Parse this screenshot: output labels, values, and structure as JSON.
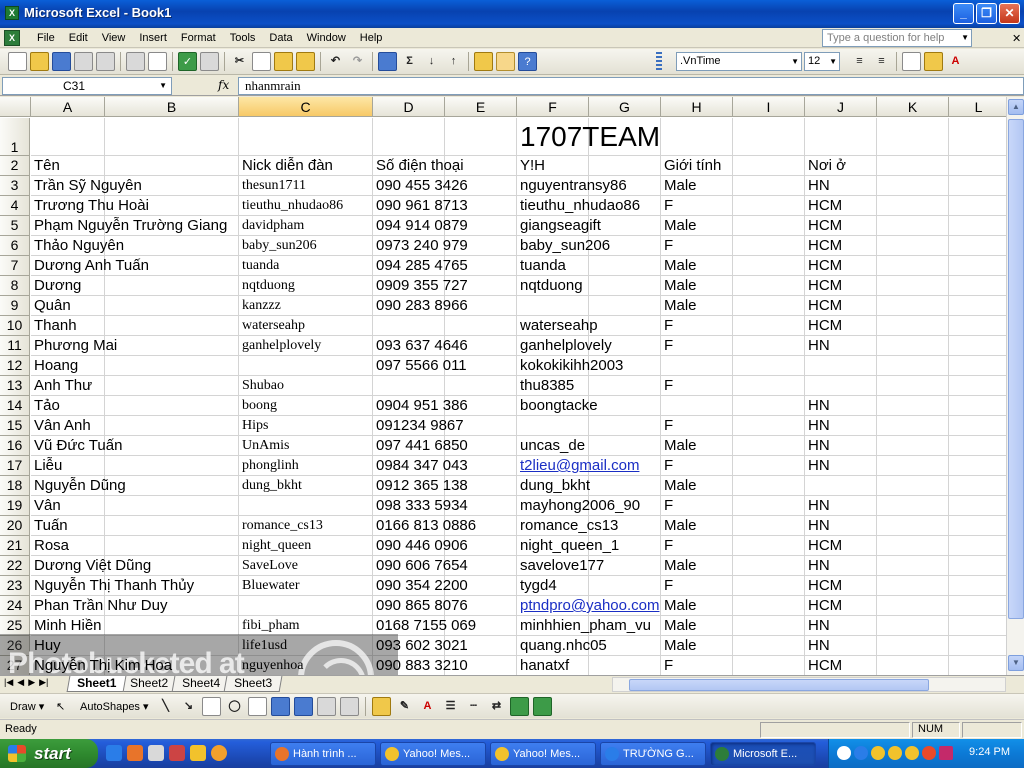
{
  "window": {
    "title": "Microsoft Excel - Book1"
  },
  "menu": {
    "items": [
      "File",
      "Edit",
      "View",
      "Insert",
      "Format",
      "Tools",
      "Data",
      "Window",
      "Help"
    ],
    "ask_placeholder": "Type a question for help"
  },
  "toolbar": {
    "sum_symbol": "Σ",
    "font_name": ".VnTime",
    "font_size": "12"
  },
  "formula_bar": {
    "cell_ref": "C31",
    "fx": "fx",
    "content": "nhanmrain"
  },
  "columns": [
    "A",
    "B",
    "C",
    "D",
    "E",
    "F",
    "G",
    "H",
    "I",
    "J",
    "K",
    "L"
  ],
  "rows": [
    {
      "n": "1",
      "title": "1707TEAM"
    },
    {
      "n": "2",
      "name": "Tên",
      "nick": "Nick diễn đàn",
      "phone": "Số điện thoại",
      "yh": "Y!H",
      "gender": "Giới tính",
      "place": "Nơi ở"
    },
    {
      "n": "3",
      "name": "Trần Sỹ Nguyên",
      "nick": "thesun1711",
      "phone": "090 455 3426",
      "yh": "nguyentransy86",
      "gender": "Male",
      "place": "HN"
    },
    {
      "n": "4",
      "name": "Trương Thu Hoài",
      "nick": "tieuthu_nhudao86",
      "phone": "090 961 8713",
      "yh": "tieuthu_nhudao86",
      "gender": "F",
      "place": "HCM"
    },
    {
      "n": "5",
      "name": "Phạm Nguyễn Trường Giang",
      "nick": "davidpham",
      "phone": "094 914 0879",
      "yh": "giangseagift",
      "gender": "Male",
      "place": "HCM"
    },
    {
      "n": "6",
      "name": "Thảo Nguyên",
      "nick": "baby_sun206",
      "phone": "0973 240 979",
      "yh": "baby_sun206",
      "gender": "F",
      "place": "HCM"
    },
    {
      "n": "7",
      "name": "Dương Anh Tuấn",
      "nick": "tuanda",
      "phone": "094 285 4765",
      "yh": "tuanda",
      "gender": "Male",
      "place": "HCM"
    },
    {
      "n": "8",
      "name": "Dương",
      "nick": "nqtduong",
      "phone": "0909 355 727",
      "yh": "nqtduong",
      "gender": "Male",
      "place": "HCM"
    },
    {
      "n": "9",
      "name": "Quân",
      "nick": "kanzzz",
      "phone": "090 283 8966",
      "yh": "",
      "gender": "Male",
      "place": "HCM"
    },
    {
      "n": "10",
      "name": "Thanh",
      "nick": "waterseahp",
      "phone": "",
      "yh": "waterseahp",
      "gender": "F",
      "place": "HCM"
    },
    {
      "n": "11",
      "name": "Phương Mai",
      "nick": "ganhelplovely",
      "phone": "093 637 4646",
      "yh": "ganhelplovely",
      "gender": "F",
      "place": "HN"
    },
    {
      "n": "12",
      "name": "Hoang",
      "nick": "",
      "phone": "097 5566 011",
      "yh": "kokokikihh2003",
      "gender": "",
      "place": ""
    },
    {
      "n": "13",
      "name": "Anh Thư",
      "nick": "Shubao",
      "phone": "",
      "yh": "thu8385",
      "gender": "F",
      "place": ""
    },
    {
      "n": "14",
      "name": "Tảo",
      "nick": "boong",
      "phone": "0904 951 386",
      "yh": "boongtacke",
      "gender": "",
      "place": "HN"
    },
    {
      "n": "15",
      "name": "Vân Anh",
      "nick": "Hips",
      "phone": "091234 9867",
      "yh": "",
      "gender": "F",
      "place": "HN"
    },
    {
      "n": "16",
      "name": "Vũ Đức Tuấn",
      "nick": "UnAmis",
      "phone": "097 441 6850",
      "yh": "uncas_de",
      "gender": "Male",
      "place": "HN"
    },
    {
      "n": "17",
      "name": "Liễu",
      "nick": "phonglinh",
      "phone": "0984 347 043",
      "yh": "t2lieu@gmail.com",
      "yh_link": true,
      "gender": "F",
      "place": "HN"
    },
    {
      "n": "18",
      "name": "Nguyễn Dũng",
      "nick": "dung_bkht",
      "phone": "0912 365 138",
      "yh": "dung_bkht",
      "gender": "Male",
      "place": ""
    },
    {
      "n": "19",
      "name": "Vân",
      "nick": "",
      "phone": "098 333 5934",
      "yh": "mayhong2006_90",
      "gender": "F",
      "place": "HN"
    },
    {
      "n": "20",
      "name": "Tuấn",
      "nick": "romance_cs13",
      "phone": "0166 813 0886",
      "yh": "romance_cs13",
      "gender": "Male",
      "place": "HN"
    },
    {
      "n": "21",
      "name": "Rosa",
      "nick": "night_queen",
      "phone": "090 446 0906",
      "yh": "night_queen_1",
      "gender": "F",
      "place": "HCM"
    },
    {
      "n": "22",
      "name": "Dương Việt Dũng",
      "nick": "SaveLove",
      "phone": "090 606 7654",
      "yh": "savelove177",
      "gender": "Male",
      "place": "HN"
    },
    {
      "n": "23",
      "name": "Nguyễn Thị Thanh Thủy",
      "nick": "Bluewater",
      "phone": "090 354 2200",
      "yh": "tygd4",
      "gender": "F",
      "place": "HCM"
    },
    {
      "n": "24",
      "name": "Phan Trần Như Duy",
      "nick": "",
      "phone": "090 865 8076",
      "yh": "ptndpro@yahoo.com",
      "yh_link": true,
      "gender": "Male",
      "place": "HCM"
    },
    {
      "n": "25",
      "name": "Minh Hiền",
      "nick": "fibi_pham",
      "phone": "0168 7155 069",
      "yh": "minhhien_pham_vu",
      "gender": "Male",
      "place": "HN"
    },
    {
      "n": "26",
      "name": "Huy",
      "nick": "life1usd",
      "phone": "093 602 3021",
      "yh": "quang.nhc05",
      "gender": "Male",
      "place": "HN"
    },
    {
      "n": "27",
      "name": "Nguyễn Thị Kim Hoa",
      "nick": "nguyenhoa",
      "phone": "090 883 3210",
      "yh": "hanatxf",
      "gender": "F",
      "place": "HCM"
    }
  ],
  "sheets": [
    "Sheet1",
    "Sheet2",
    "Sheet4",
    "Sheet3"
  ],
  "drawing": {
    "draw_label": "Draw",
    "autoshapes_label": "AutoShapes"
  },
  "status": {
    "ready": "Ready",
    "num": "NUM"
  },
  "watermark": {
    "text_line1": "Photobucketed at",
    "text_line2": "photobucket"
  },
  "taskbar": {
    "start": "start",
    "items": [
      "Hành trình ...",
      "Yahoo! Mes...",
      "Yahoo! Mes...",
      "TRƯỜNG G...",
      "Microsoft E..."
    ],
    "clock": "9:24 PM"
  }
}
